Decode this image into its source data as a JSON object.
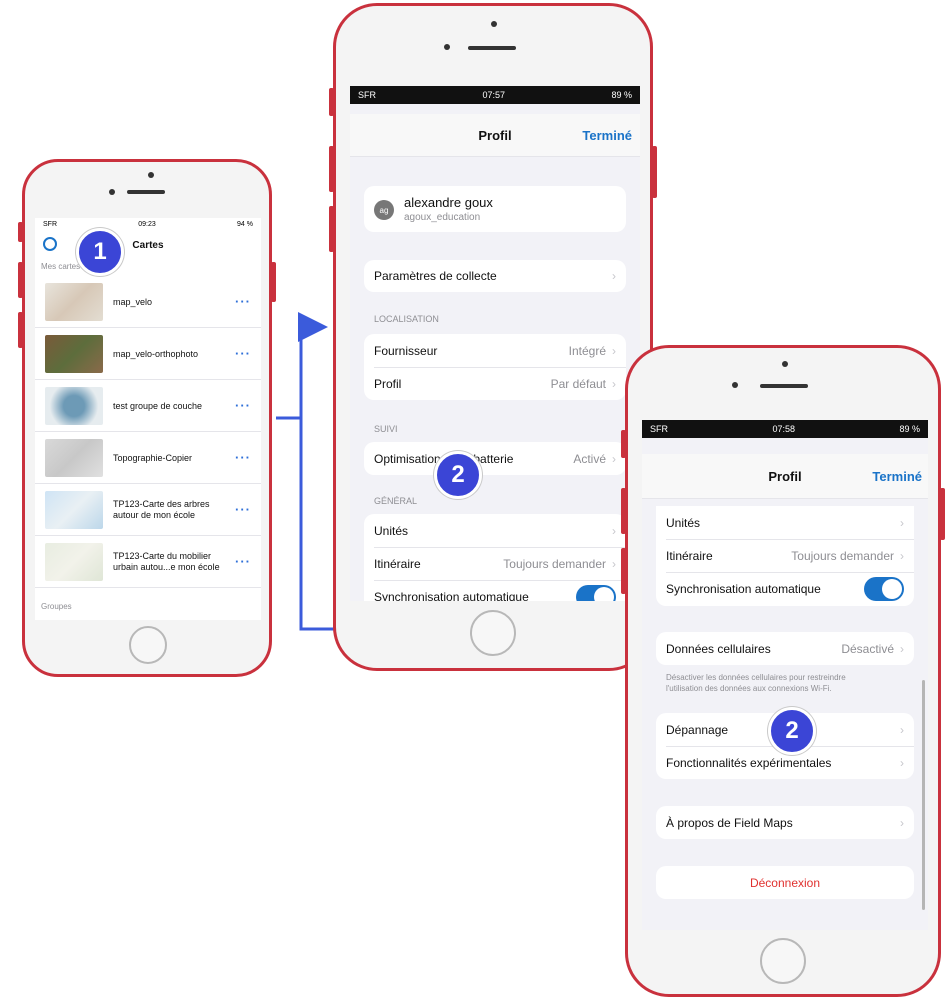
{
  "phone1": {
    "status": {
      "carrier": "SFR",
      "time": "09:23",
      "battery": "94 %"
    },
    "title": "Cartes",
    "section_my_maps": "Mes cartes",
    "maps": [
      {
        "name": "map_velo",
        "thumb": "map-thumb-icon"
      },
      {
        "name": "map_velo-orthophoto",
        "thumb": "orthophoto-thumb-icon"
      },
      {
        "name": "test groupe de couche",
        "thumb": "layer-group-thumb-icon"
      },
      {
        "name": "Topographie-Copier",
        "thumb": "world-thumb-icon"
      },
      {
        "name_line1": "TP123-Carte des arbres",
        "name_line2": "autour de mon école"
      },
      {
        "name_line1": "TP123-Carte du mobilier",
        "name_line2": "urbain autou...e mon école"
      }
    ],
    "more_label": "···",
    "section_groups": "Groupes",
    "step_badge": "1"
  },
  "phone2": {
    "status": {
      "carrier": "SFR",
      "time": "07:57",
      "battery": "89 %"
    },
    "title": "Profil",
    "done": "Terminé",
    "user": {
      "initials": "ag",
      "name": "alexandre goux",
      "username": "agoux_education"
    },
    "collect_settings": "Paramètres de collecte",
    "section_location": "LOCALISATION",
    "provider_label": "Fournisseur",
    "provider_value": "Intégré",
    "profile_label": "Profil",
    "profile_value": "Par défaut",
    "section_tracking": "SUIVI",
    "battery_label": "Optimisation de la batterie",
    "battery_value": "Activé",
    "section_general": "GÉNÉRAL",
    "units_label": "Unités",
    "route_label": "Itinéraire",
    "route_value": "Toujours demander",
    "sync_label": "Synchronisation automatique",
    "step_badge": "2"
  },
  "phone3": {
    "status": {
      "carrier": "SFR",
      "time": "07:58",
      "battery": "89 %"
    },
    "title": "Profil",
    "done": "Terminé",
    "units_label": "Unités",
    "route_label": "Itinéraire",
    "route_value": "Toujours demander",
    "sync_label": "Synchronisation automatique",
    "sync_on": true,
    "cellular_label": "Données cellulaires",
    "cellular_value": "Désactivé",
    "cellular_note_line1": "Désactiver les données cellulaires pour restreindre",
    "cellular_note_line2": "l'utilisation des données aux connexions Wi-Fi.",
    "troubleshoot_label": "Dépannage",
    "experimental_label": "Fonctionnalités expérimentales",
    "about_label": "À propos de Field Maps",
    "logout_label": "Déconnexion",
    "step_badge": "2"
  },
  "colors": {
    "frame": "#c9313d",
    "accent": "#1a73c8",
    "badge": "#3b45d6",
    "arrow": "#3b5bdb",
    "logout": "#e0312f"
  }
}
